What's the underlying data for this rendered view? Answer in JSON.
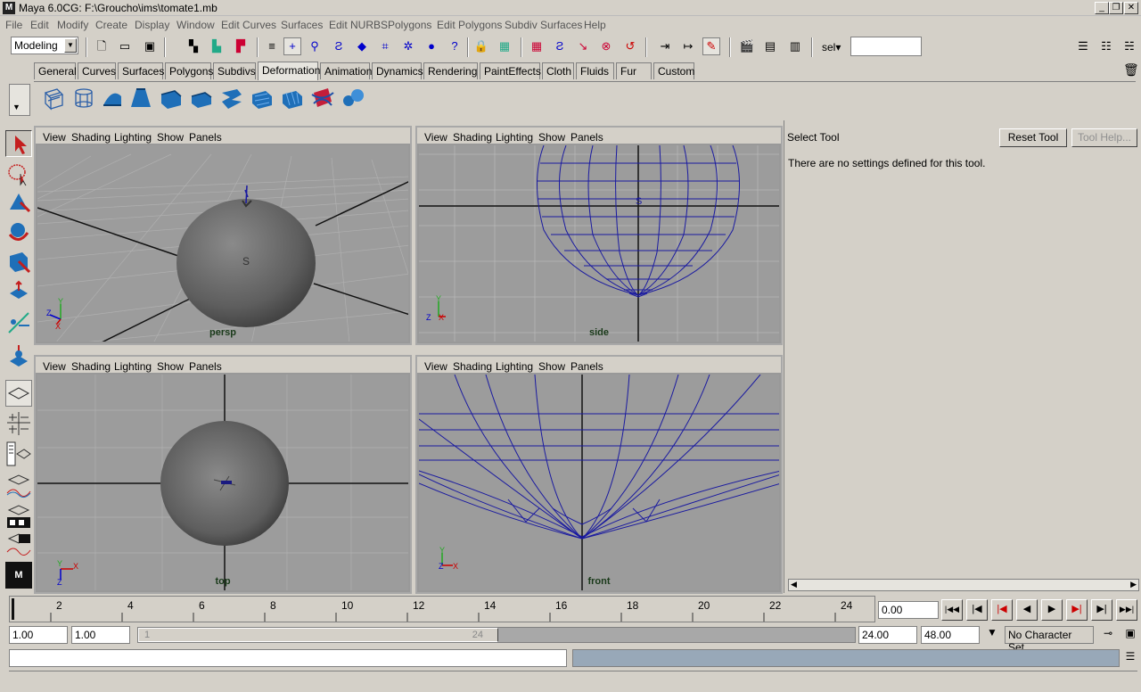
{
  "window": {
    "title": "Maya 6.0CG: F:\\Groucho\\ims\\tomate1.mb",
    "logo": "M"
  },
  "menu": [
    "File",
    "Edit",
    "Modify",
    "Create",
    "Display",
    "Window",
    "Edit Curves",
    "Surfaces",
    "Edit NURBS",
    "Polygons",
    "Edit Polygons",
    "Subdiv Surfaces",
    "Help"
  ],
  "toolbar": {
    "mode": "Modeling",
    "sel_label": "sel",
    "sel_value": ""
  },
  "shelf_tabs": [
    "General",
    "Curves",
    "Surfaces",
    "Polygons",
    "Subdivs",
    "Deformation",
    "Animation",
    "Dynamics",
    "Rendering",
    "PaintEffects",
    "Cloth",
    "Fluids",
    "Fur",
    "Custom"
  ],
  "shelf_active": "Deformation",
  "panel_menu": [
    "View",
    "Shading",
    "Lighting",
    "Show",
    "Panels"
  ],
  "viewports": {
    "persp": "persp",
    "side": "side",
    "top": "top",
    "front": "front"
  },
  "object_label": "S",
  "axes": {
    "x": "X",
    "y": "Y",
    "z": "Z"
  },
  "attr": {
    "tool_name": "Select Tool",
    "reset": "Reset Tool",
    "help": "Tool Help...",
    "message": "There are no settings defined for this tool."
  },
  "timeline": {
    "ticks": [
      "2",
      "4",
      "6",
      "8",
      "10",
      "12",
      "14",
      "16",
      "18",
      "20",
      "22",
      "24"
    ],
    "current_time": "0.00"
  },
  "range": {
    "start": "1.00",
    "start2": "1.00",
    "slider_start": "1",
    "slider_end": "24",
    "end": "24.00",
    "end2": "48.00",
    "char_set": "No Character Set"
  },
  "status": {
    "command_line": ""
  }
}
